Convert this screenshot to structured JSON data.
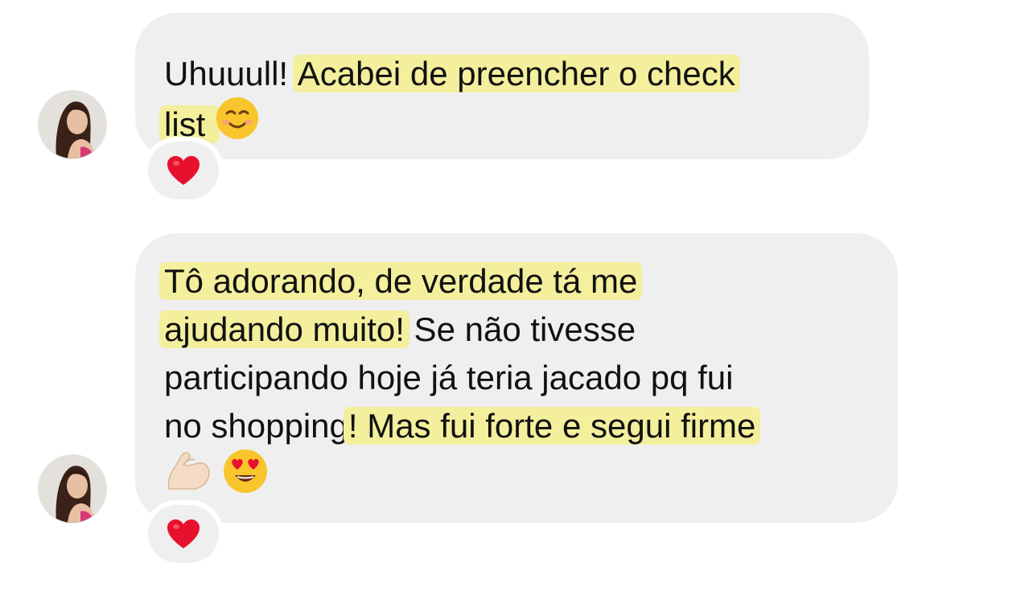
{
  "conversation": {
    "messages": [
      {
        "lines": [
          [
            {
              "text": "Uhuuull! ",
              "highlight": false
            },
            {
              "text": "Acabei de preencher o check",
              "highlight": true
            }
          ],
          [
            {
              "text": "list ",
              "highlight": true
            },
            {
              "emoji": "smiling-face-icon"
            }
          ]
        ],
        "reaction": "heart-icon"
      },
      {
        "lines": [
          [
            {
              "text": "Tô adorando, de verdade tá me",
              "highlight": true
            }
          ],
          [
            {
              "text": "ajudando muito!",
              "highlight": true
            },
            {
              "text": " Se não tivesse",
              "highlight": false
            }
          ],
          [
            {
              "text": "participando hoje já teria jacado pq fui",
              "highlight": false
            }
          ],
          [
            {
              "text": "no shopping",
              "highlight": false
            },
            {
              "text": "! Mas fui forte e segui firme",
              "highlight": true
            }
          ],
          [
            {
              "emoji": "flexed-biceps-icon"
            },
            {
              "emoji": "heart-eyes-face-icon"
            }
          ]
        ],
        "reaction": "heart-icon"
      }
    ]
  },
  "colors": {
    "bubble": "#efefef",
    "highlight": "#f3ef9d",
    "heart": "#e8112d"
  }
}
